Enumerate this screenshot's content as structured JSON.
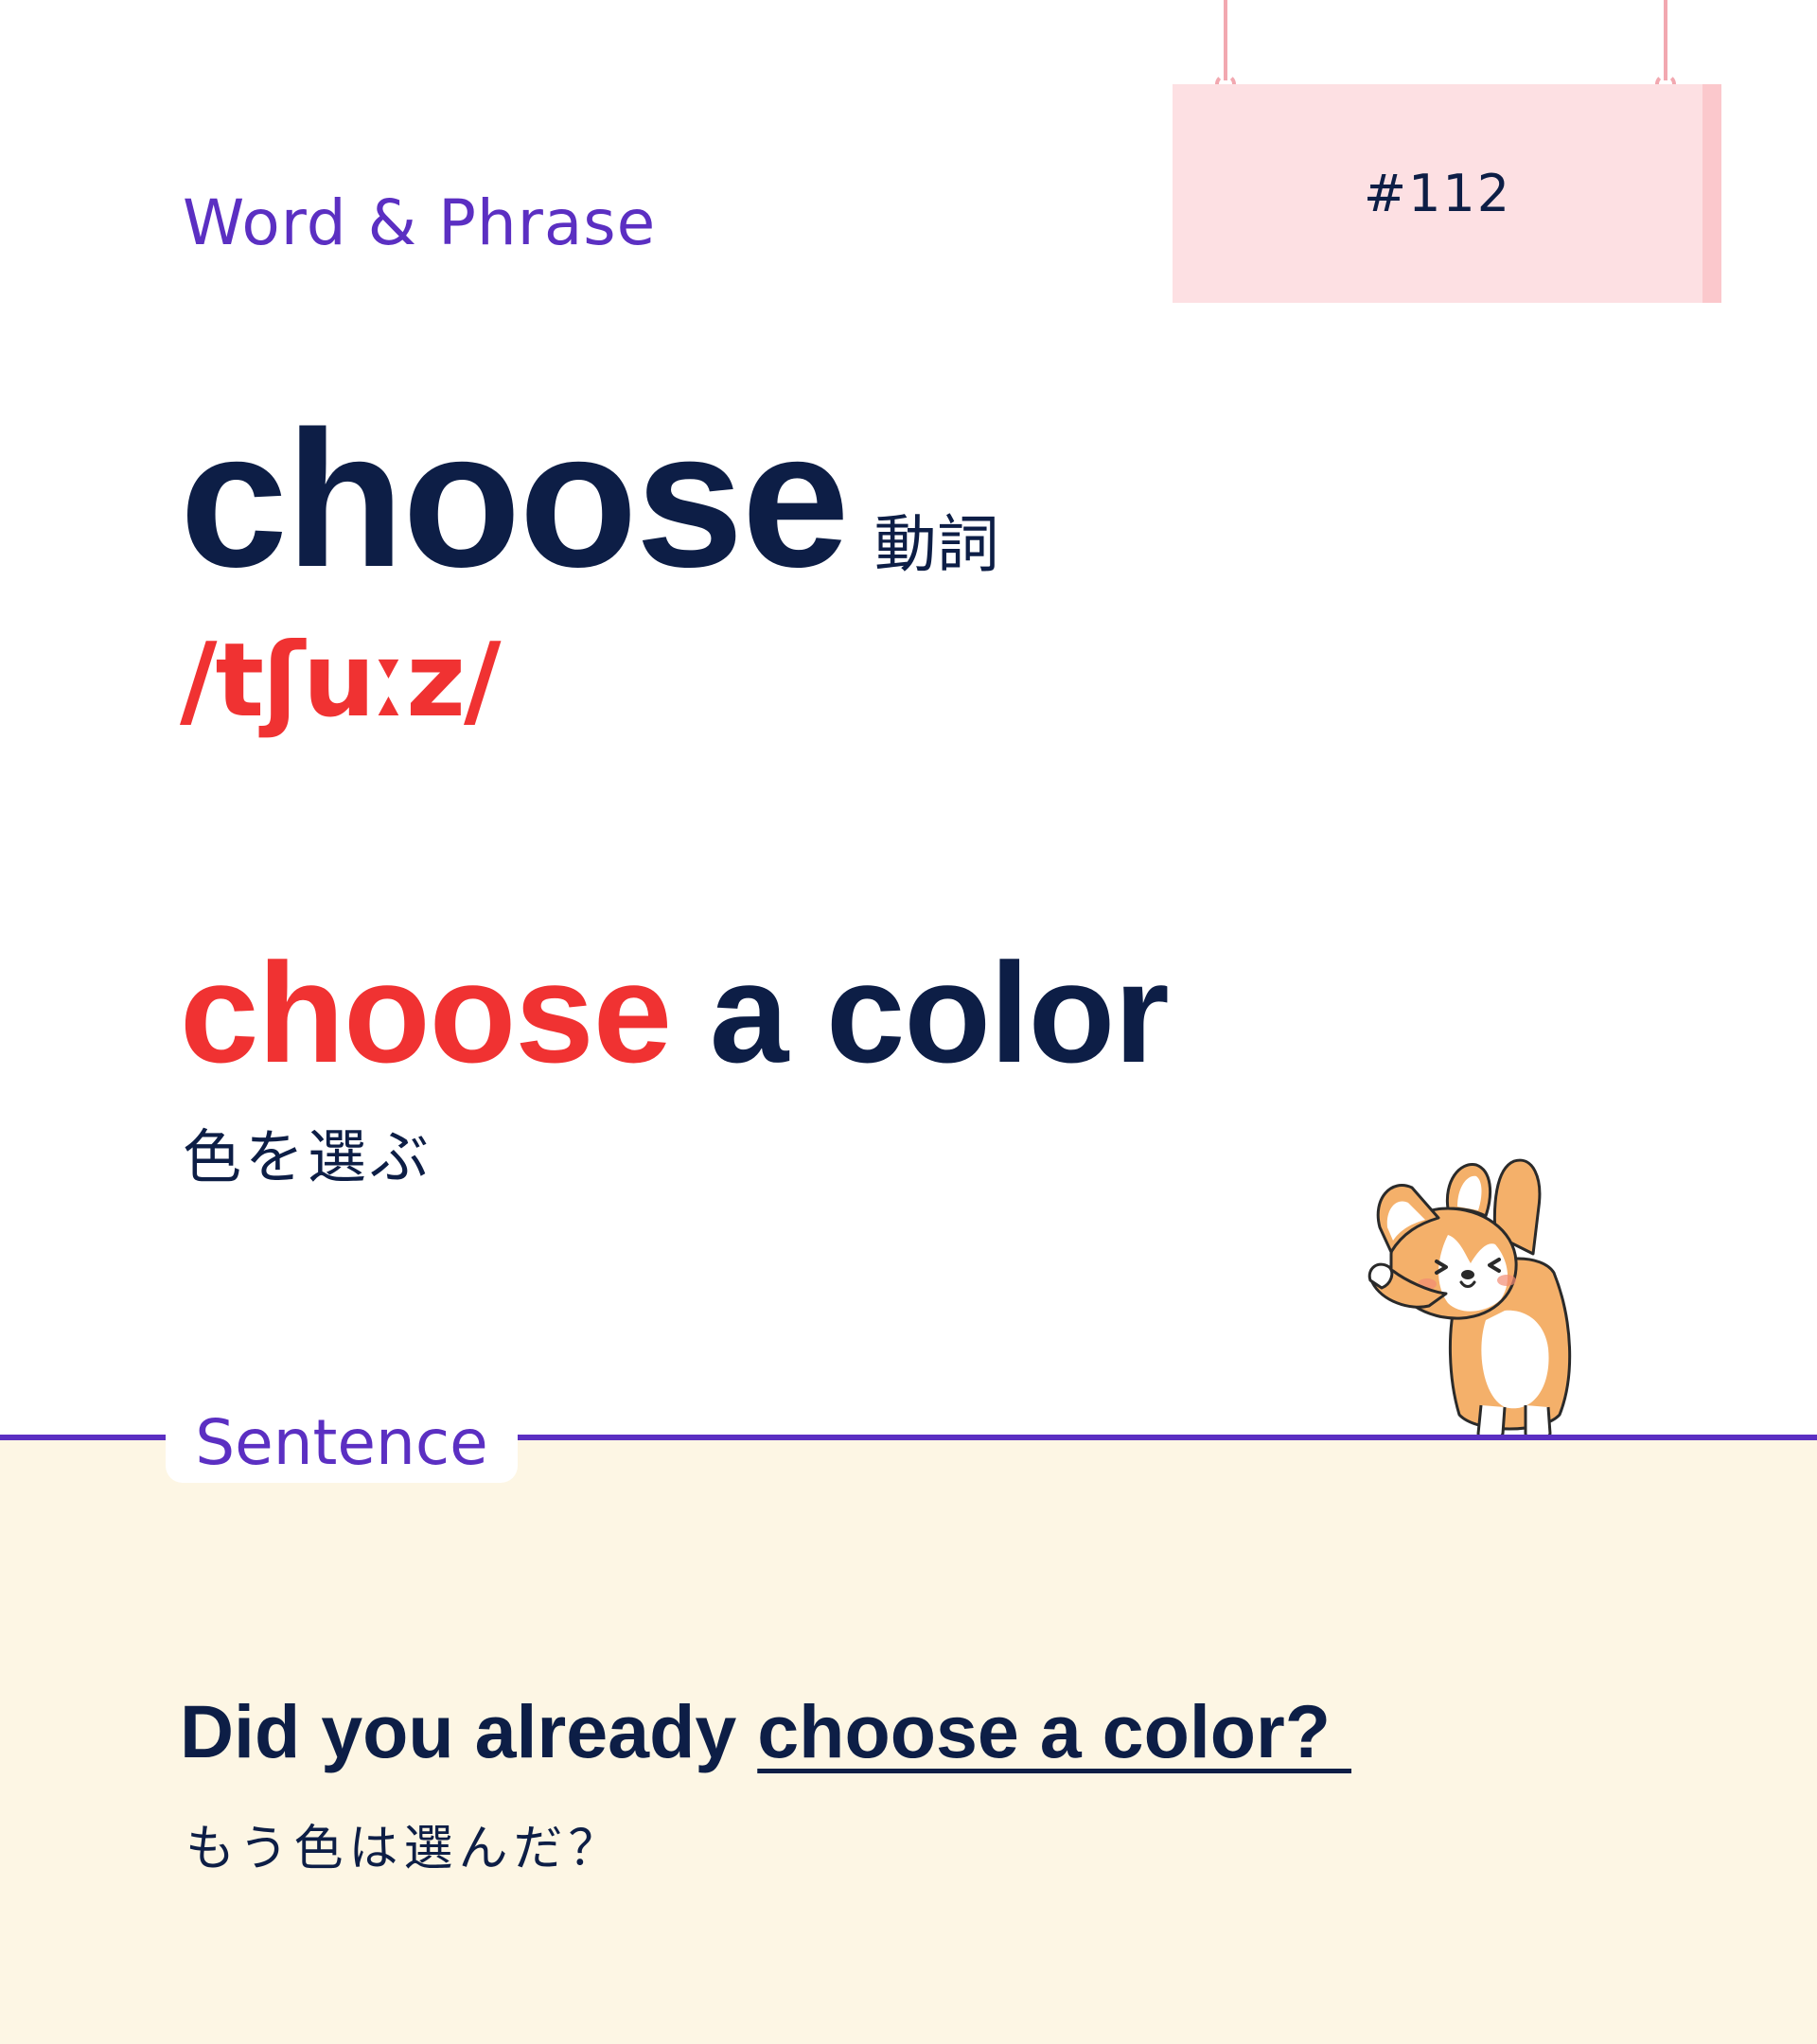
{
  "section": {
    "word_phrase_label": "Word & Phrase",
    "sentence_label": "Sentence"
  },
  "sign": {
    "number": "#112"
  },
  "word": {
    "text": "choose",
    "part_of_speech": "動詞",
    "ipa": "/tʃuːz/"
  },
  "phrase": {
    "highlight": "choose",
    "rest": " a color",
    "translation": "色を選ぶ"
  },
  "sentence": {
    "prefix": "Did you already ",
    "underlined": "choose a color? ",
    "translation": "もう色は選んだ？"
  },
  "colors": {
    "navy": "#0d1e46",
    "red": "#f03232",
    "purple": "#5b2fc2",
    "sign_pink": "#fde0e3",
    "cream": "#fdf6e4"
  },
  "illustration": {
    "icon": "corgi-illustration"
  }
}
